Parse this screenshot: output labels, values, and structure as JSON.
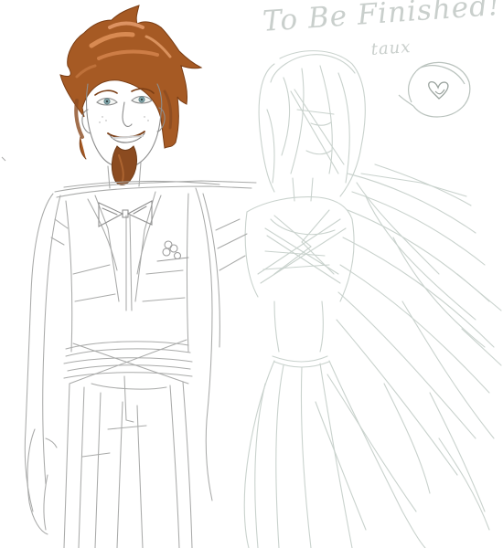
{
  "artwork": {
    "note_text": "To Be Finished!",
    "signature": "taux",
    "colors": {
      "hair": "#a65a24",
      "hair_light": "#e0935a",
      "beard": "#8b4b20",
      "sketch_line": "#a9aaa9",
      "faint_line": "#c9d2cd",
      "background": "#ffffff"
    },
    "figures": [
      {
        "name": "man-in-suit",
        "rendering": "partially colored sketch",
        "features": [
          "spiky brown hair",
          "goatee",
          "bow tie",
          "pocket flower",
          "waistcoat"
        ]
      },
      {
        "name": "woman-in-gown",
        "rendering": "faint pencil sketch",
        "features": [
          "long hair",
          "arms crossed over chest",
          "flowing skirt"
        ]
      }
    ],
    "speech_bubble_icon": "heart-icon"
  }
}
